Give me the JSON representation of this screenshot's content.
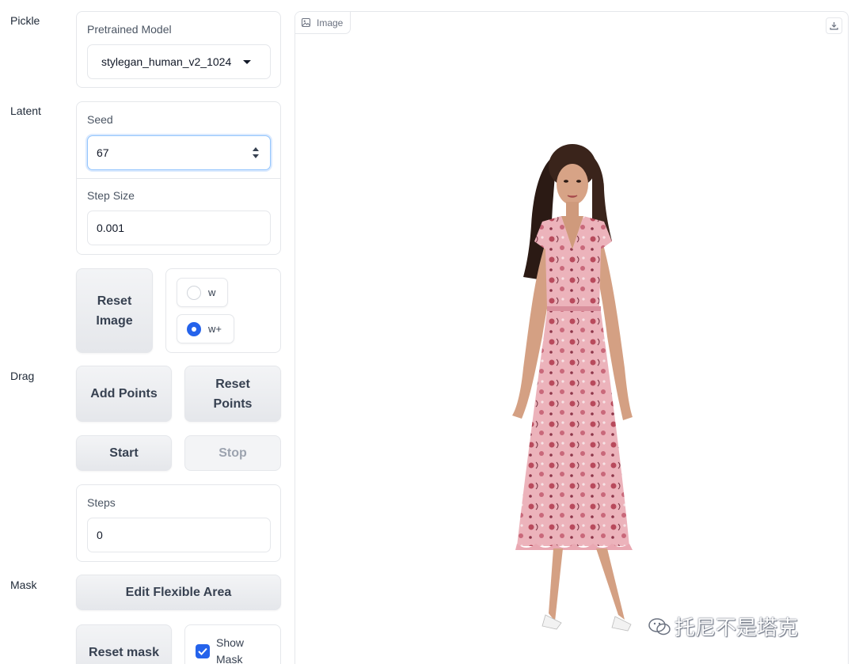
{
  "sections": {
    "pickle": "Pickle",
    "latent": "Latent",
    "drag": "Drag",
    "mask": "Mask"
  },
  "pickle": {
    "model_label": "Pretrained Model",
    "model_value": "stylegan_human_v2_1024"
  },
  "latent": {
    "seed_label": "Seed",
    "seed_value": "67",
    "step_size_label": "Step Size",
    "step_size_value": "0.001",
    "reset_image_label": "Reset Image",
    "space_options": [
      {
        "label": "w",
        "checked": false
      },
      {
        "label": "w+",
        "checked": true
      }
    ]
  },
  "drag": {
    "add_points_label": "Add Points",
    "reset_points_label": "Reset Points",
    "start_label": "Start",
    "stop_label": "Stop",
    "steps_label": "Steps",
    "steps_value": "0"
  },
  "mask": {
    "edit_flexible_area_label": "Edit Flexible Area",
    "reset_mask_label": "Reset mask",
    "show_mask_label": "Show Mask",
    "show_mask_checked": true
  },
  "image_panel": {
    "tag_label": "Image",
    "download_icon": "download-icon",
    "watermark_text": "托尼不是塔克"
  },
  "colors": {
    "accent": "#2563eb",
    "focus_border": "#93c5fd",
    "dress_pink": "#e8aab3",
    "floral_red": "#b84a5c"
  }
}
